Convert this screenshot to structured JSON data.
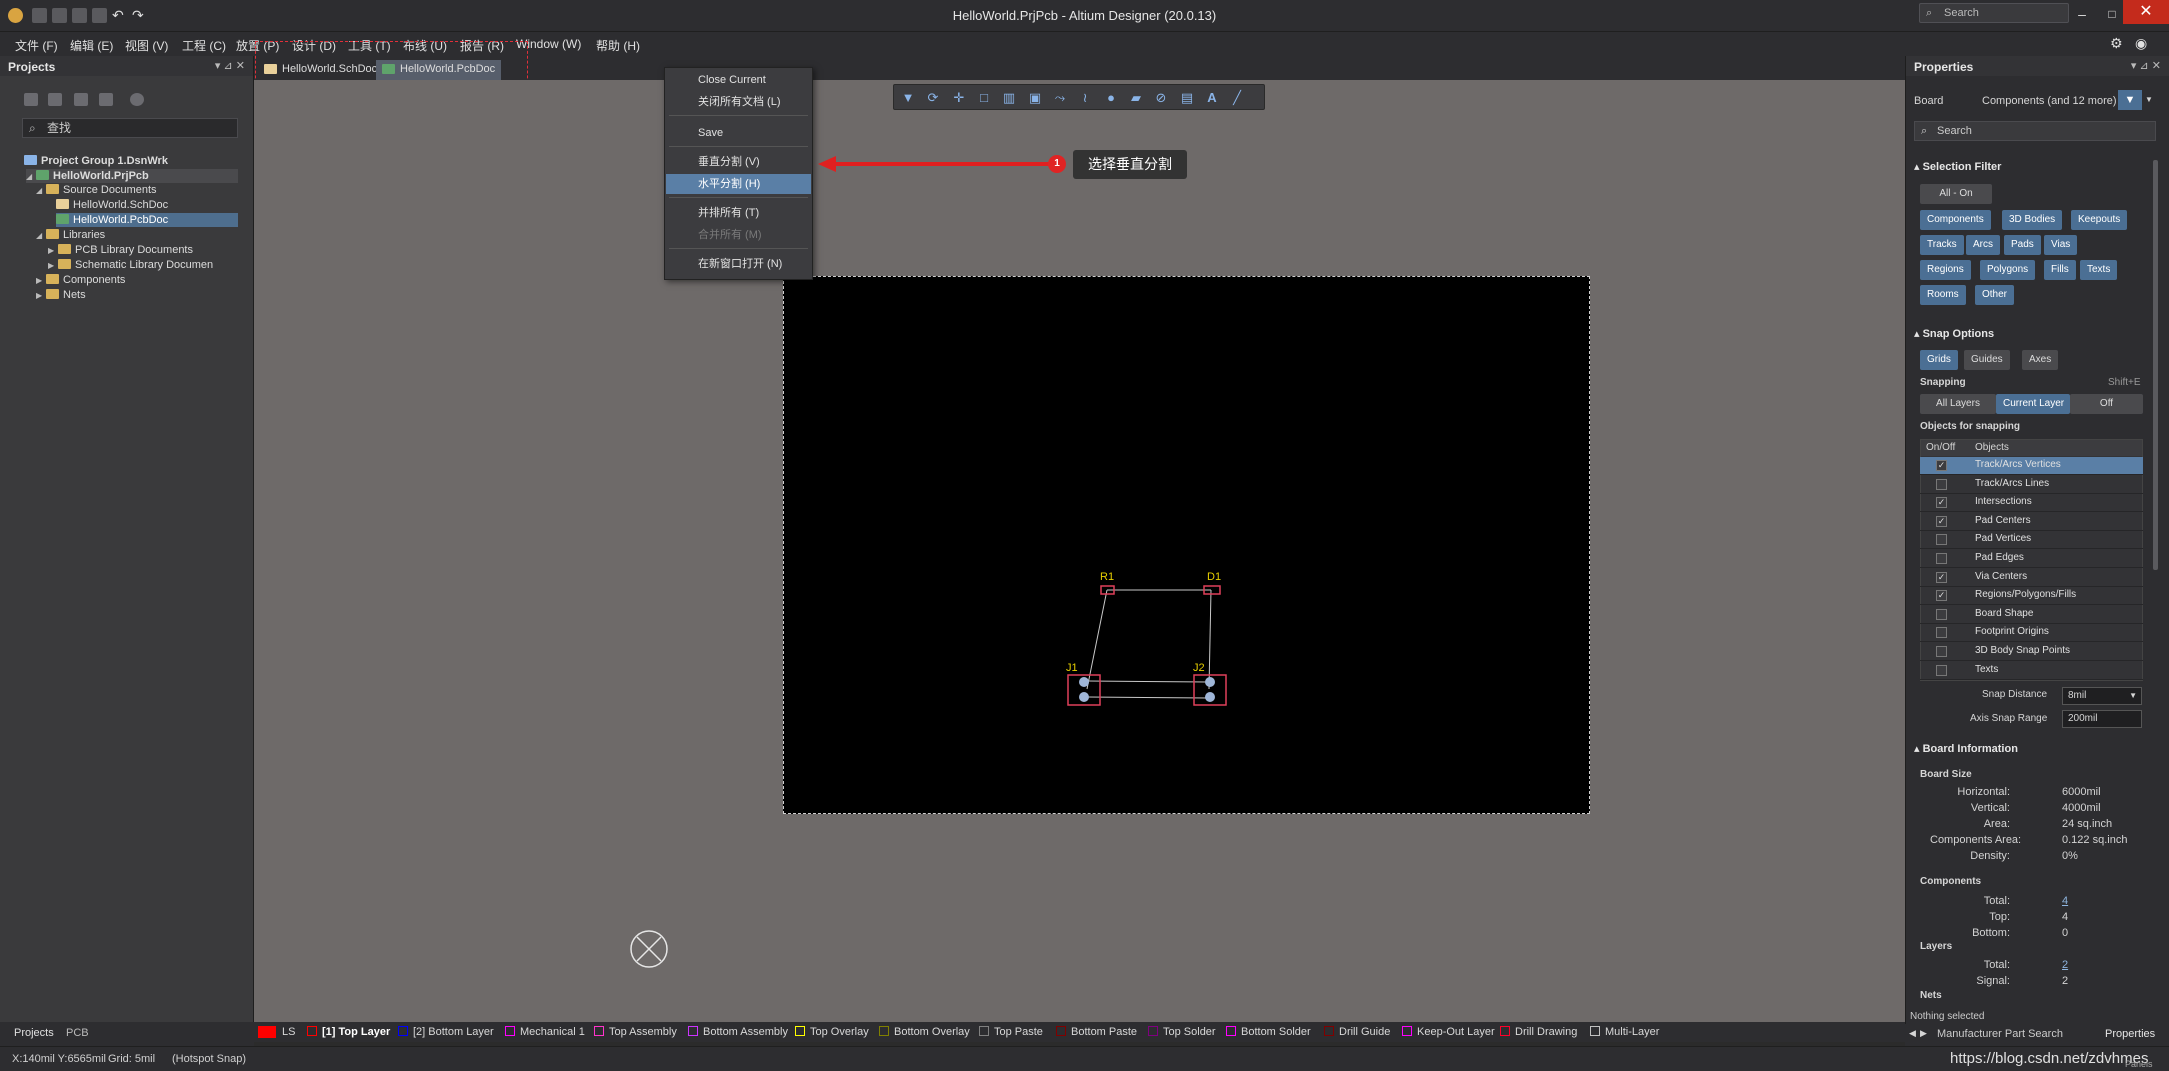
{
  "app": {
    "title": "HelloWorld.PrjPcb - Altium Designer (20.0.13)",
    "search_placeholder": "Search"
  },
  "menu": [
    "文件 (F)",
    "编辑 (E)",
    "视图 (V)",
    "工程 (C)",
    "放置 (P)",
    "设计 (D)",
    "工具 (T)",
    "布线 (U)",
    "报告 (R)",
    "Window (W)",
    "帮助 (H)"
  ],
  "projects_panel": {
    "title": "Projects",
    "search_placeholder": "查找",
    "tree": [
      "Project Group 1.DsnWrk",
      "HelloWorld.PrjPcb",
      "Source Documents",
      "HelloWorld.SchDoc",
      "HelloWorld.PcbDoc",
      "Libraries",
      "PCB Library Documents",
      "Schematic Library Documen",
      "Components",
      "Nets"
    ],
    "bottom_tabs": [
      "Projects",
      "PCB"
    ]
  },
  "doc_tabs": [
    "HelloWorld.SchDoc",
    "HelloWorld.PcbDoc"
  ],
  "context_menu": [
    {
      "label": "Close Current",
      "state": "normal"
    },
    {
      "label": "关闭所有文档 (L)",
      "state": "normal"
    },
    {
      "label": "Save",
      "state": "normal"
    },
    {
      "label": "垂直分割 (V)",
      "state": "normal"
    },
    {
      "label": "水平分割 (H)",
      "state": "highlighted"
    },
    {
      "label": "并排所有 (T)",
      "state": "normal"
    },
    {
      "label": "合并所有 (M)",
      "state": "disabled"
    },
    {
      "label": "在新窗口打开 (N)",
      "state": "normal"
    }
  ],
  "callout": {
    "number": "1",
    "text": "选择垂直分割",
    "color": "#e02424"
  },
  "pcb": {
    "components": [
      "R1",
      "D1",
      "J1",
      "J2"
    ],
    "silk_color": "#e8d000",
    "pad_color": "#e0405a"
  },
  "properties": {
    "title": "Properties",
    "board_label": "Board",
    "board_value": "Components (and 12 more)",
    "search_placeholder": "Search",
    "selection_filter": {
      "title": "Selection Filter",
      "all_on": "All - On",
      "chips": [
        "Components",
        "3D Bodies",
        "Keepouts",
        "Tracks",
        "Arcs",
        "Pads",
        "Vias",
        "Regions",
        "Polygons",
        "Fills",
        "Texts",
        "Rooms",
        "Other"
      ]
    },
    "snap_options": {
      "title": "Snap Options",
      "modes": [
        "Grids",
        "Guides",
        "Axes"
      ],
      "snapping_label": "Snapping",
      "snapping_shortcut": "Shift+E",
      "snapping_choices": [
        "All Layers",
        "Current Layer",
        "Off"
      ],
      "objects_title": "Objects for snapping",
      "col_onoff": "On/Off",
      "col_objects": "Objects",
      "objects": [
        {
          "name": "Track/Arcs Vertices",
          "on": true
        },
        {
          "name": "Track/Arcs Lines",
          "on": false
        },
        {
          "name": "Intersections",
          "on": true
        },
        {
          "name": "Pad Centers",
          "on": true
        },
        {
          "name": "Pad Vertices",
          "on": false
        },
        {
          "name": "Pad Edges",
          "on": false
        },
        {
          "name": "Via Centers",
          "on": true
        },
        {
          "name": "Regions/Polygons/Fills",
          "on": true
        },
        {
          "name": "Board Shape",
          "on": false
        },
        {
          "name": "Footprint Origins",
          "on": false
        },
        {
          "name": "3D Body Snap Points",
          "on": false
        },
        {
          "name": "Texts",
          "on": false
        }
      ],
      "snap_distance_label": "Snap Distance",
      "snap_distance_value": "8mil",
      "axis_snap_label": "Axis Snap Range",
      "axis_snap_value": "200mil"
    },
    "board_info": {
      "title": "Board Information",
      "size_title": "Board Size",
      "horizontal_k": "Horizontal:",
      "horizontal_v": "6000mil",
      "vertical_k": "Vertical:",
      "vertical_v": "4000mil",
      "area_k": "Area:",
      "area_v": "24 sq.inch",
      "comp_area_k": "Components Area:",
      "comp_area_v": "0.122 sq.inch",
      "density_k": "Density:",
      "density_v": "0%",
      "components_title": "Components",
      "total_k": "Total:",
      "total_v": "4",
      "top_k": "Top:",
      "top_v": "4",
      "bottom_k": "Bottom:",
      "bottom_v": "0",
      "layers_title": "Layers",
      "ltotal_k": "Total:",
      "ltotal_v": "2",
      "signal_k": "Signal:",
      "signal_v": "2",
      "nets_title": "Nets",
      "nothing_selected": "Nothing selected"
    },
    "bottom_tabs": [
      "Manufacturer Part Search",
      "Properties"
    ]
  },
  "layers": [
    {
      "name": "[1] Top Layer",
      "color": "#ff0000",
      "active": true
    },
    {
      "name": "[2] Bottom Layer",
      "color": "#0000ff"
    },
    {
      "name": "Mechanical 1",
      "color": "#ff00ff"
    },
    {
      "name": "Top Assembly",
      "color": "#ff33cc"
    },
    {
      "name": "Bottom Assembly",
      "color": "#cc33ff"
    },
    {
      "name": "Top Overlay",
      "color": "#ffff00"
    },
    {
      "name": "Bottom Overlay",
      "color": "#808000"
    },
    {
      "name": "Top Paste",
      "color": "#808080"
    },
    {
      "name": "Bottom Paste",
      "color": "#800000"
    },
    {
      "name": "Top Solder",
      "color": "#800080"
    },
    {
      "name": "Bottom Solder",
      "color": "#ff00ff"
    },
    {
      "name": "Drill Guide",
      "color": "#800000"
    },
    {
      "name": "Keep-Out Layer",
      "color": "#ff00ff"
    },
    {
      "name": "Drill Drawing",
      "color": "#ff002a"
    },
    {
      "name": "Multi-Layer",
      "color": "#c0c0c0"
    }
  ],
  "layer_set": "LS",
  "status": {
    "coords": "X:140mil Y:6565mil",
    "grid": "Grid: 5mil",
    "snap": "(Hotspot Snap)",
    "watermark": "https://blog.csdn.net/zdvhmes",
    "panels": "Panels"
  }
}
